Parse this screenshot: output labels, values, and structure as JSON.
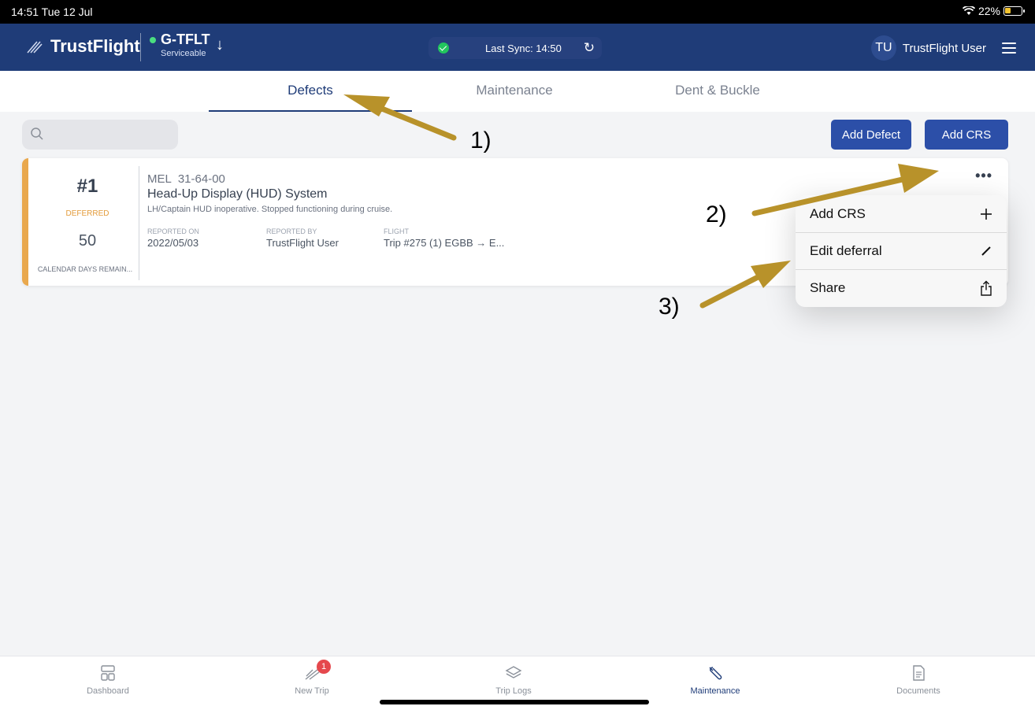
{
  "status_bar": {
    "time": "14:51  Tue 12 Jul",
    "battery": "22%"
  },
  "header": {
    "brand": "TrustFlight",
    "aircraft_reg": "G-TFLT",
    "aircraft_status": "Serviceable",
    "sync_text": "Last Sync: 14:50",
    "user_initials": "TU",
    "user_name": "TrustFlight User"
  },
  "tabs": [
    {
      "label": "Defects",
      "active": true
    },
    {
      "label": "Maintenance",
      "active": false
    },
    {
      "label": "Dent & Buckle",
      "active": false
    }
  ],
  "search": {
    "placeholder": "",
    "value": ""
  },
  "actions": {
    "add_defect": "Add Defect",
    "add_crs": "Add CRS"
  },
  "defect": {
    "number": "#1",
    "status": "DEFERRED",
    "days": "50",
    "days_label": "CALENDAR DAYS REMAIN...",
    "type": "MEL",
    "code": "31-64-00",
    "title": "Head-Up Display (HUD) System",
    "description": "LH/Captain HUD inoperative. Stopped functioning during cruise.",
    "reported_on_label": "REPORTED ON",
    "reported_on": "2022/05/03",
    "reported_by_label": "REPORTED BY",
    "reported_by": "TrustFlight User",
    "flight_label": "FLIGHT",
    "flight": "Trip #275 (1) EGBB → E..."
  },
  "menu": [
    {
      "label": "Add CRS",
      "icon": "plus-icon"
    },
    {
      "label": "Edit deferral",
      "icon": "pencil-icon"
    },
    {
      "label": "Share",
      "icon": "share-icon"
    }
  ],
  "annotations": {
    "a1": "1)",
    "a2": "2)",
    "a3": "3)",
    "arrow_color": "#b8922a"
  },
  "bottom_nav": [
    {
      "label": "Dashboard",
      "icon": "dashboard-icon",
      "active": false
    },
    {
      "label": "New Trip",
      "icon": "new-trip-icon",
      "active": false,
      "badge": "1"
    },
    {
      "label": "Trip Logs",
      "icon": "trip-logs-icon",
      "active": false
    },
    {
      "label": "Maintenance",
      "icon": "wrench-icon",
      "active": true
    },
    {
      "label": "Documents",
      "icon": "documents-icon",
      "active": false
    }
  ],
  "colors": {
    "header": "#1f3c78",
    "accent": "#2c4fa8",
    "deferred": "#e9a84d"
  }
}
